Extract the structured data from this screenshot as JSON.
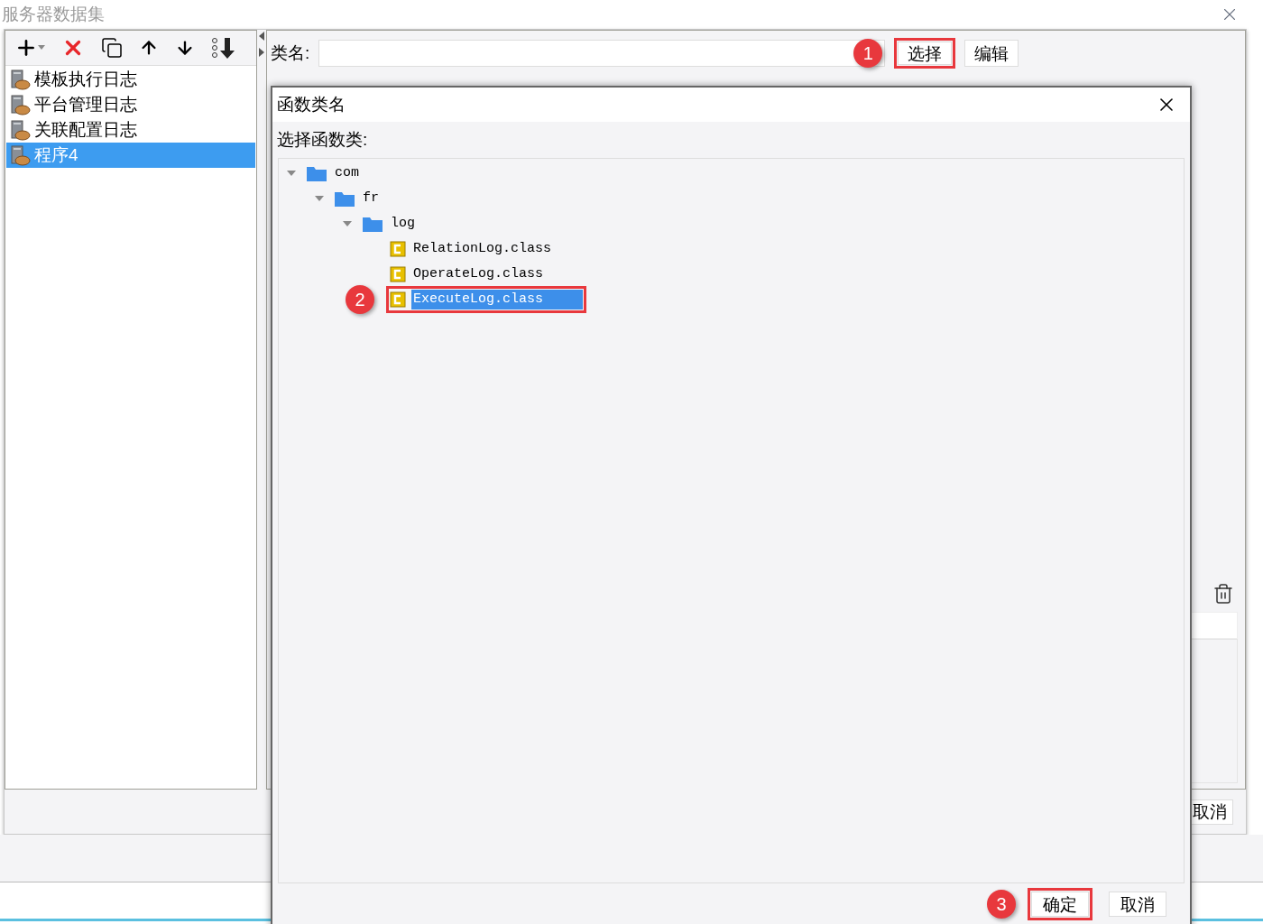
{
  "window": {
    "title": "服务器数据集"
  },
  "datasets": [
    {
      "label": "模板执行日志",
      "selected": false
    },
    {
      "label": "平台管理日志",
      "selected": false
    },
    {
      "label": "关联配置日志",
      "selected": false
    },
    {
      "label": "程序4",
      "selected": true
    }
  ],
  "class_name": {
    "label": "类名:"
  },
  "select_button": {
    "label": "选择",
    "callout": "1"
  },
  "edit_button": {
    "label": "编辑"
  },
  "background_cancel_button": {
    "label": "取消"
  },
  "dialog": {
    "title": "函数类名",
    "prompt": "选择函数类:",
    "tree": [
      {
        "label": "com",
        "kind": "folder",
        "expanded": true,
        "children": [
          {
            "label": "fr",
            "kind": "folder",
            "expanded": true,
            "children": [
              {
                "label": "log",
                "kind": "folder",
                "expanded": true,
                "children": [
                  {
                    "label": "RelationLog.class",
                    "kind": "class",
                    "selected": false
                  },
                  {
                    "label": "OperateLog.class",
                    "kind": "class",
                    "selected": false
                  },
                  {
                    "label": "ExecuteLog.class",
                    "kind": "class",
                    "selected": true,
                    "callout": "2"
                  }
                ]
              }
            ]
          }
        ]
      }
    ],
    "buttons": [
      {
        "label": "确定",
        "callout": "3"
      },
      {
        "label": "取消"
      }
    ]
  }
}
